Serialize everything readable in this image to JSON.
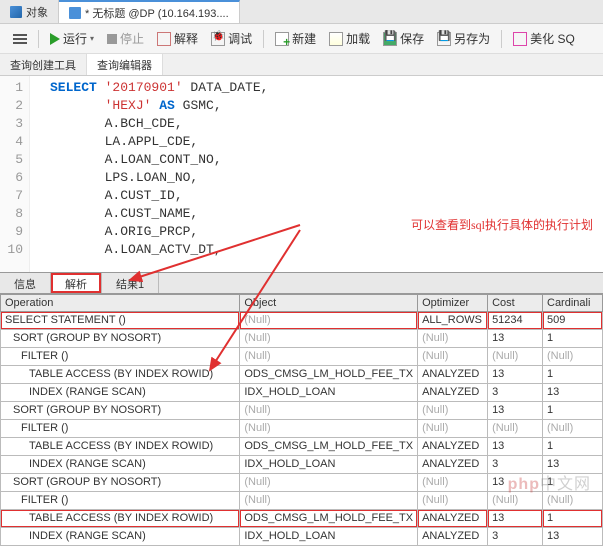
{
  "top_tabs": {
    "objects": "对象",
    "untitled": "* 无标题 @DP (10.164.193...."
  },
  "toolbar": {
    "run": "运行",
    "stop": "停止",
    "explain": "解释",
    "debug": "调试",
    "new": "新建",
    "load": "加载",
    "save": "保存",
    "saveas": "另存为",
    "beautify": "美化 SQ"
  },
  "sub_tabs": {
    "builder": "查询创建工具",
    "editor": "查询编辑器"
  },
  "code_lines": [
    {
      "tokens": [
        [
          "kw",
          "SELECT "
        ],
        [
          "str",
          "'20170901'"
        ],
        [
          "ident",
          " DATA_DATE,"
        ]
      ]
    },
    {
      "tokens": [
        [
          "ident",
          "       "
        ],
        [
          "str",
          "'HEXJ'"
        ],
        [
          "ident",
          " "
        ],
        [
          "kw",
          "AS"
        ],
        [
          "ident",
          " GSMC,"
        ]
      ]
    },
    {
      "tokens": [
        [
          "ident",
          "       A.BCH_CDE,"
        ]
      ]
    },
    {
      "tokens": [
        [
          "ident",
          "       LA.APPL_CDE,"
        ]
      ]
    },
    {
      "tokens": [
        [
          "ident",
          "       A.LOAN_CONT_NO,"
        ]
      ]
    },
    {
      "tokens": [
        [
          "ident",
          "       LPS.LOAN_NO,"
        ]
      ]
    },
    {
      "tokens": [
        [
          "ident",
          "       A.CUST_ID,"
        ]
      ]
    },
    {
      "tokens": [
        [
          "ident",
          "       A.CUST_NAME,"
        ]
      ]
    },
    {
      "tokens": [
        [
          "ident",
          "       A.ORIG_PRCP,"
        ]
      ]
    },
    {
      "tokens": [
        [
          "ident",
          "       A.LOAN_ACTV_DT,"
        ]
      ]
    }
  ],
  "gutter": [
    "1",
    "2",
    "3",
    "4",
    "5",
    "6",
    "7",
    "8",
    "9",
    "10"
  ],
  "annotation": "可以查看到sql执行具体的执行计划",
  "result_tabs": {
    "info": "信息",
    "explain": "解析",
    "result1": "结果1"
  },
  "plan": {
    "headers": {
      "operation": "Operation",
      "object": "Object",
      "optimizer": "Optimizer",
      "cost": "Cost",
      "cardinality": "Cardinali"
    },
    "rows": [
      {
        "boxed": true,
        "indent": 0,
        "op": "SELECT STATEMENT ()",
        "obj": "(Null)",
        "obj_null": true,
        "opt": "ALL_ROWS",
        "opt_null": false,
        "cost": "51234",
        "card": "509"
      },
      {
        "boxed": false,
        "indent": 1,
        "op": "SORT (GROUP BY NOSORT)",
        "obj": "(Null)",
        "obj_null": true,
        "opt": "(Null)",
        "opt_null": true,
        "cost": "13",
        "card": "1"
      },
      {
        "boxed": false,
        "indent": 2,
        "op": "FILTER ()",
        "obj": "(Null)",
        "obj_null": true,
        "opt": "(Null)",
        "opt_null": true,
        "cost": "(Null)",
        "cost_null": true,
        "card": "(Null)",
        "card_null": true
      },
      {
        "boxed": false,
        "indent": 3,
        "op": "TABLE ACCESS (BY INDEX ROWID)",
        "obj": "ODS_CMSG_LM_HOLD_FEE_TX",
        "obj_null": false,
        "opt": "ANALYZED",
        "opt_null": false,
        "cost": "13",
        "card": "1"
      },
      {
        "boxed": false,
        "indent": 3,
        "op": "INDEX (RANGE SCAN)",
        "obj": "IDX_HOLD_LOAN",
        "obj_null": false,
        "opt": "ANALYZED",
        "opt_null": false,
        "cost": "3",
        "card": "13"
      },
      {
        "boxed": false,
        "indent": 1,
        "op": "SORT (GROUP BY NOSORT)",
        "obj": "(Null)",
        "obj_null": true,
        "opt": "(Null)",
        "opt_null": true,
        "cost": "13",
        "card": "1"
      },
      {
        "boxed": false,
        "indent": 2,
        "op": "FILTER ()",
        "obj": "(Null)",
        "obj_null": true,
        "opt": "(Null)",
        "opt_null": true,
        "cost": "(Null)",
        "cost_null": true,
        "card": "(Null)",
        "card_null": true
      },
      {
        "boxed": false,
        "indent": 3,
        "op": "TABLE ACCESS (BY INDEX ROWID)",
        "obj": "ODS_CMSG_LM_HOLD_FEE_TX",
        "obj_null": false,
        "opt": "ANALYZED",
        "opt_null": false,
        "cost": "13",
        "card": "1"
      },
      {
        "boxed": false,
        "indent": 3,
        "op": "INDEX (RANGE SCAN)",
        "obj": "IDX_HOLD_LOAN",
        "obj_null": false,
        "opt": "ANALYZED",
        "opt_null": false,
        "cost": "3",
        "card": "13"
      },
      {
        "boxed": false,
        "indent": 1,
        "op": "SORT (GROUP BY NOSORT)",
        "obj": "(Null)",
        "obj_null": true,
        "opt": "(Null)",
        "opt_null": true,
        "cost": "13",
        "card": "1"
      },
      {
        "boxed": false,
        "indent": 2,
        "op": "FILTER ()",
        "obj": "(Null)",
        "obj_null": true,
        "opt": "(Null)",
        "opt_null": true,
        "cost": "(Null)",
        "cost_null": true,
        "card": "(Null)",
        "card_null": true
      },
      {
        "boxed": true,
        "indent": 3,
        "op": "TABLE ACCESS (BY INDEX ROWID)",
        "obj": "ODS_CMSG_LM_HOLD_FEE_TX",
        "obj_null": false,
        "opt": "ANALYZED",
        "opt_null": false,
        "cost": "13",
        "card": "1"
      },
      {
        "boxed": false,
        "indent": 3,
        "op": "INDEX (RANGE SCAN)",
        "obj": "IDX_HOLD_LOAN",
        "obj_null": false,
        "opt": "ANALYZED",
        "opt_null": false,
        "cost": "3",
        "card": "13"
      }
    ]
  },
  "watermark": "php中文网"
}
